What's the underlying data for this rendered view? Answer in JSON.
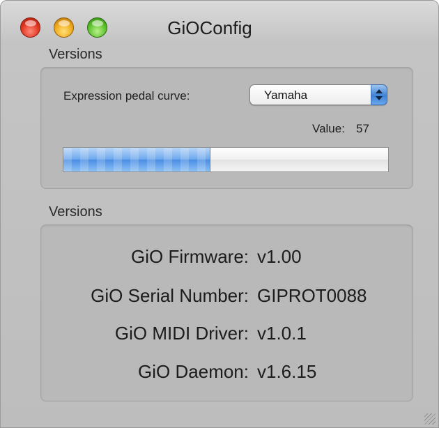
{
  "window": {
    "title": "GiOConfig"
  },
  "pedal_group": {
    "label": "Versions",
    "pedal_curve_label": "Expression pedal curve:",
    "pedal_curve_value": "Yamaha",
    "value_label": "Value:",
    "value": "57",
    "progress_fraction": 0.45
  },
  "versions_group": {
    "label": "Versions",
    "rows": [
      {
        "label": "GiO Firmware:",
        "value": "v1.00"
      },
      {
        "label": "GiO Serial Number:",
        "value": "GIPROT0088"
      },
      {
        "label": "GiO MIDI Driver:",
        "value": "v1.0.1"
      },
      {
        "label": "GiO Daemon:",
        "value": "v1.6.15"
      }
    ]
  },
  "colors": {
    "progress_fill": "#4a8ee4",
    "select_arrow": "#3f82d6",
    "close_button": "#e0341e",
    "minimize_button": "#f0a81a",
    "zoom_button": "#5cc02c"
  }
}
